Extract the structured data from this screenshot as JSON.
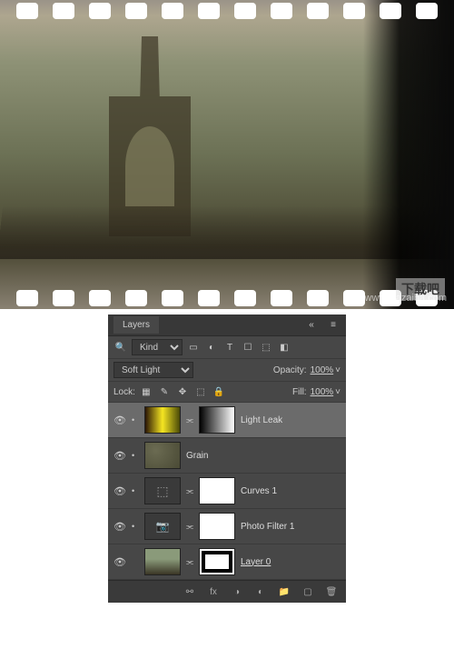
{
  "photo": {
    "watermark": "www.xiazaiba.com",
    "corner_logo": "下载吧"
  },
  "panel": {
    "title": "Layers",
    "filter_kind": "Kind",
    "blend_mode": "Soft Light",
    "opacity_label": "Opacity:",
    "opacity_value": "100%",
    "lock_label": "Lock:",
    "fill_label": "Fill:",
    "fill_value": "100%"
  },
  "layers": [
    {
      "name": "Light Leak",
      "visible": true
    },
    {
      "name": "Grain",
      "visible": true
    },
    {
      "name": "Curves 1",
      "visible": true
    },
    {
      "name": "Photo Filter 1",
      "visible": true
    },
    {
      "name": "Layer 0",
      "visible": true
    }
  ],
  "icons": {
    "eye": "👁",
    "menu": "≡",
    "collapse": "«",
    "search": "🔍",
    "chevron": "˅",
    "link_fx": "fx",
    "mask_circle": "◑",
    "adjust": "◐",
    "folder": "📁",
    "new": "▢",
    "trash": "🗑",
    "link": "⚯",
    "dot": "•"
  }
}
